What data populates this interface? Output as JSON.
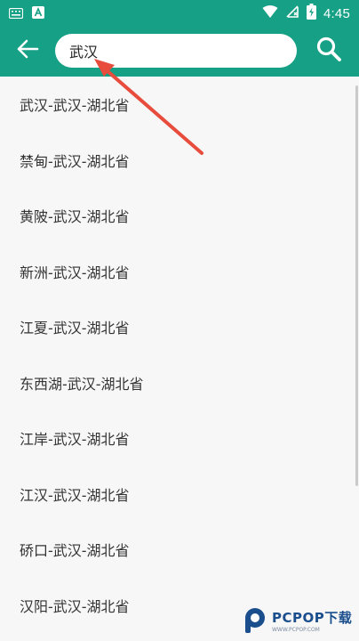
{
  "colors": {
    "primary": "#16a085",
    "background": "#f7f7f7",
    "arrow": "#e74c3c",
    "text": "#333333"
  },
  "status_bar": {
    "time": "4:45",
    "icons": [
      "keyboard-icon",
      "a-notification-icon",
      "wifi-icon",
      "no-sim-icon",
      "battery-icon"
    ]
  },
  "app_bar": {
    "back_icon": "arrow-left-icon",
    "search_value": "武汉",
    "search_icon": "search-icon"
  },
  "results": [
    {
      "label": "武汉-武汉-湖北省"
    },
    {
      "label": "禁甸-武汉-湖北省"
    },
    {
      "label": "黄陂-武汉-湖北省"
    },
    {
      "label": "新洲-武汉-湖北省"
    },
    {
      "label": "江夏-武汉-湖北省"
    },
    {
      "label": "东西湖-武汉-湖北省"
    },
    {
      "label": "江岸-武汉-湖北省"
    },
    {
      "label": "江汉-武汉-湖北省"
    },
    {
      "label": "硚口-武汉-湖北省"
    },
    {
      "label": "汉阳-武汉-湖北省"
    }
  ],
  "watermark": {
    "main": "PCPOP下载",
    "sub": "WWW.PCPOP.COM"
  }
}
